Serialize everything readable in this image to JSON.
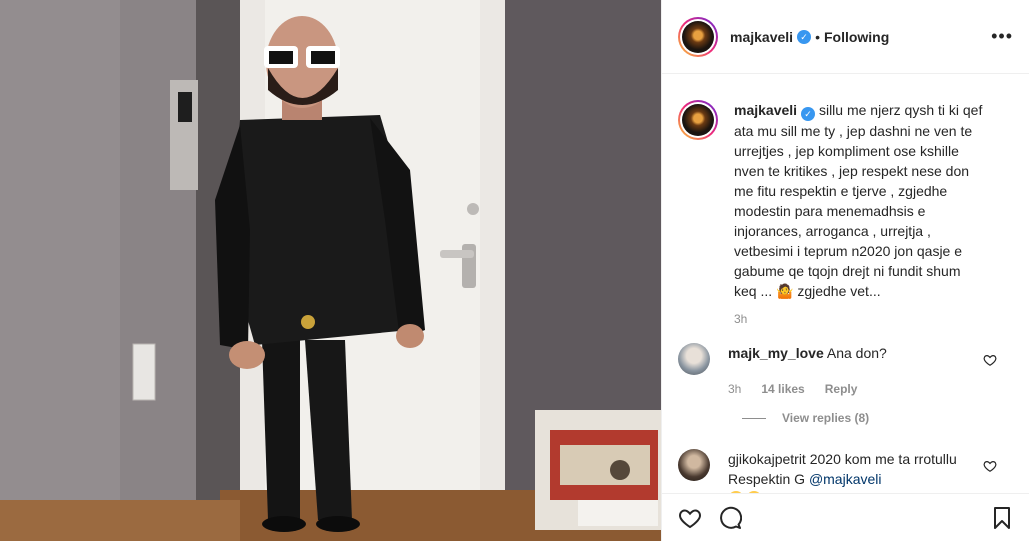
{
  "post": {
    "author": "majkaveli",
    "follow_status": "Following",
    "more_label": "•••",
    "caption_author": "majkaveli",
    "caption": "sillu me njerz qysh ti ki qef ata mu sill me ty , jep dashni ne ven te urrejtjes , jep kompliment ose kshille nven te kritikes , jep respekt nese don me fitu respektin e tjerve , zgjedhe modestin para menemadhsis e injorances, arroganca , urrejtja , vetbesimi i teprum n2020 jon qasje e gabume qe tqojn drejt ni fundit shum keq ... 🤷 zgjedhe vet...",
    "caption_age": "3h"
  },
  "comments": [
    {
      "user": "majk_my_love",
      "text": "Ana don?",
      "age": "3h",
      "likes": "14 likes",
      "reply_label": "Reply",
      "view_replies": "View replies (8)"
    },
    {
      "user": "gjikokajpetrit",
      "text": "2020 kom me ta rrotullu Respektin G",
      "mention": "@majkaveli"
    }
  ],
  "icons": [
    "verified-badge-icon",
    "heart-icon",
    "comment-icon",
    "bookmark-icon",
    "more-options-icon"
  ],
  "colors": {
    "verified": "#3897f0",
    "mention": "#003569",
    "muted": "#8e8e8e"
  }
}
